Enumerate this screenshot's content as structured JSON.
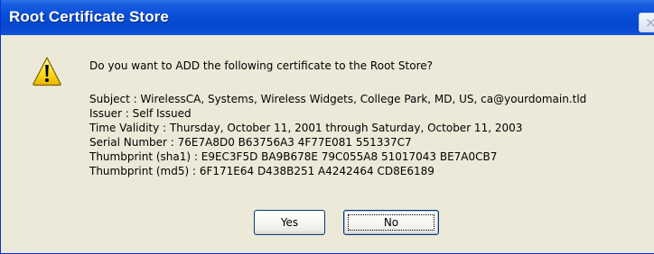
{
  "window": {
    "title": "Root Certificate Store",
    "close_glyph": "×"
  },
  "icon": "warning-icon",
  "message": {
    "question": "Do you want to ADD the following certificate to the Root Store?",
    "subject": "Subject : WirelessCA, Systems, Wireless Widgets, College Park, MD, US, ca@yourdomain.tld",
    "issuer": "Issuer : Self Issued",
    "time_validity": "Time Validity : Thursday, October 11, 2001 through Saturday, October 11, 2003",
    "serial_number": "Serial Number : 76E7A8D0 B63756A3 4F77E081 551337C7",
    "thumbprint_sha1": "Thumbprint (sha1) : E9EC3F5D BA9B678E 79C055A8 51017043 BE7A0CB7",
    "thumbprint_md5": "Thumbprint (md5) : 6F171E64 D438B251 A4242464 CD8E6189"
  },
  "buttons": {
    "yes": "Yes",
    "no": "No"
  },
  "colors": {
    "titlebar": "#0a4fd8",
    "dialog_bg": "#ece9d8",
    "button_border": "#003c74"
  }
}
